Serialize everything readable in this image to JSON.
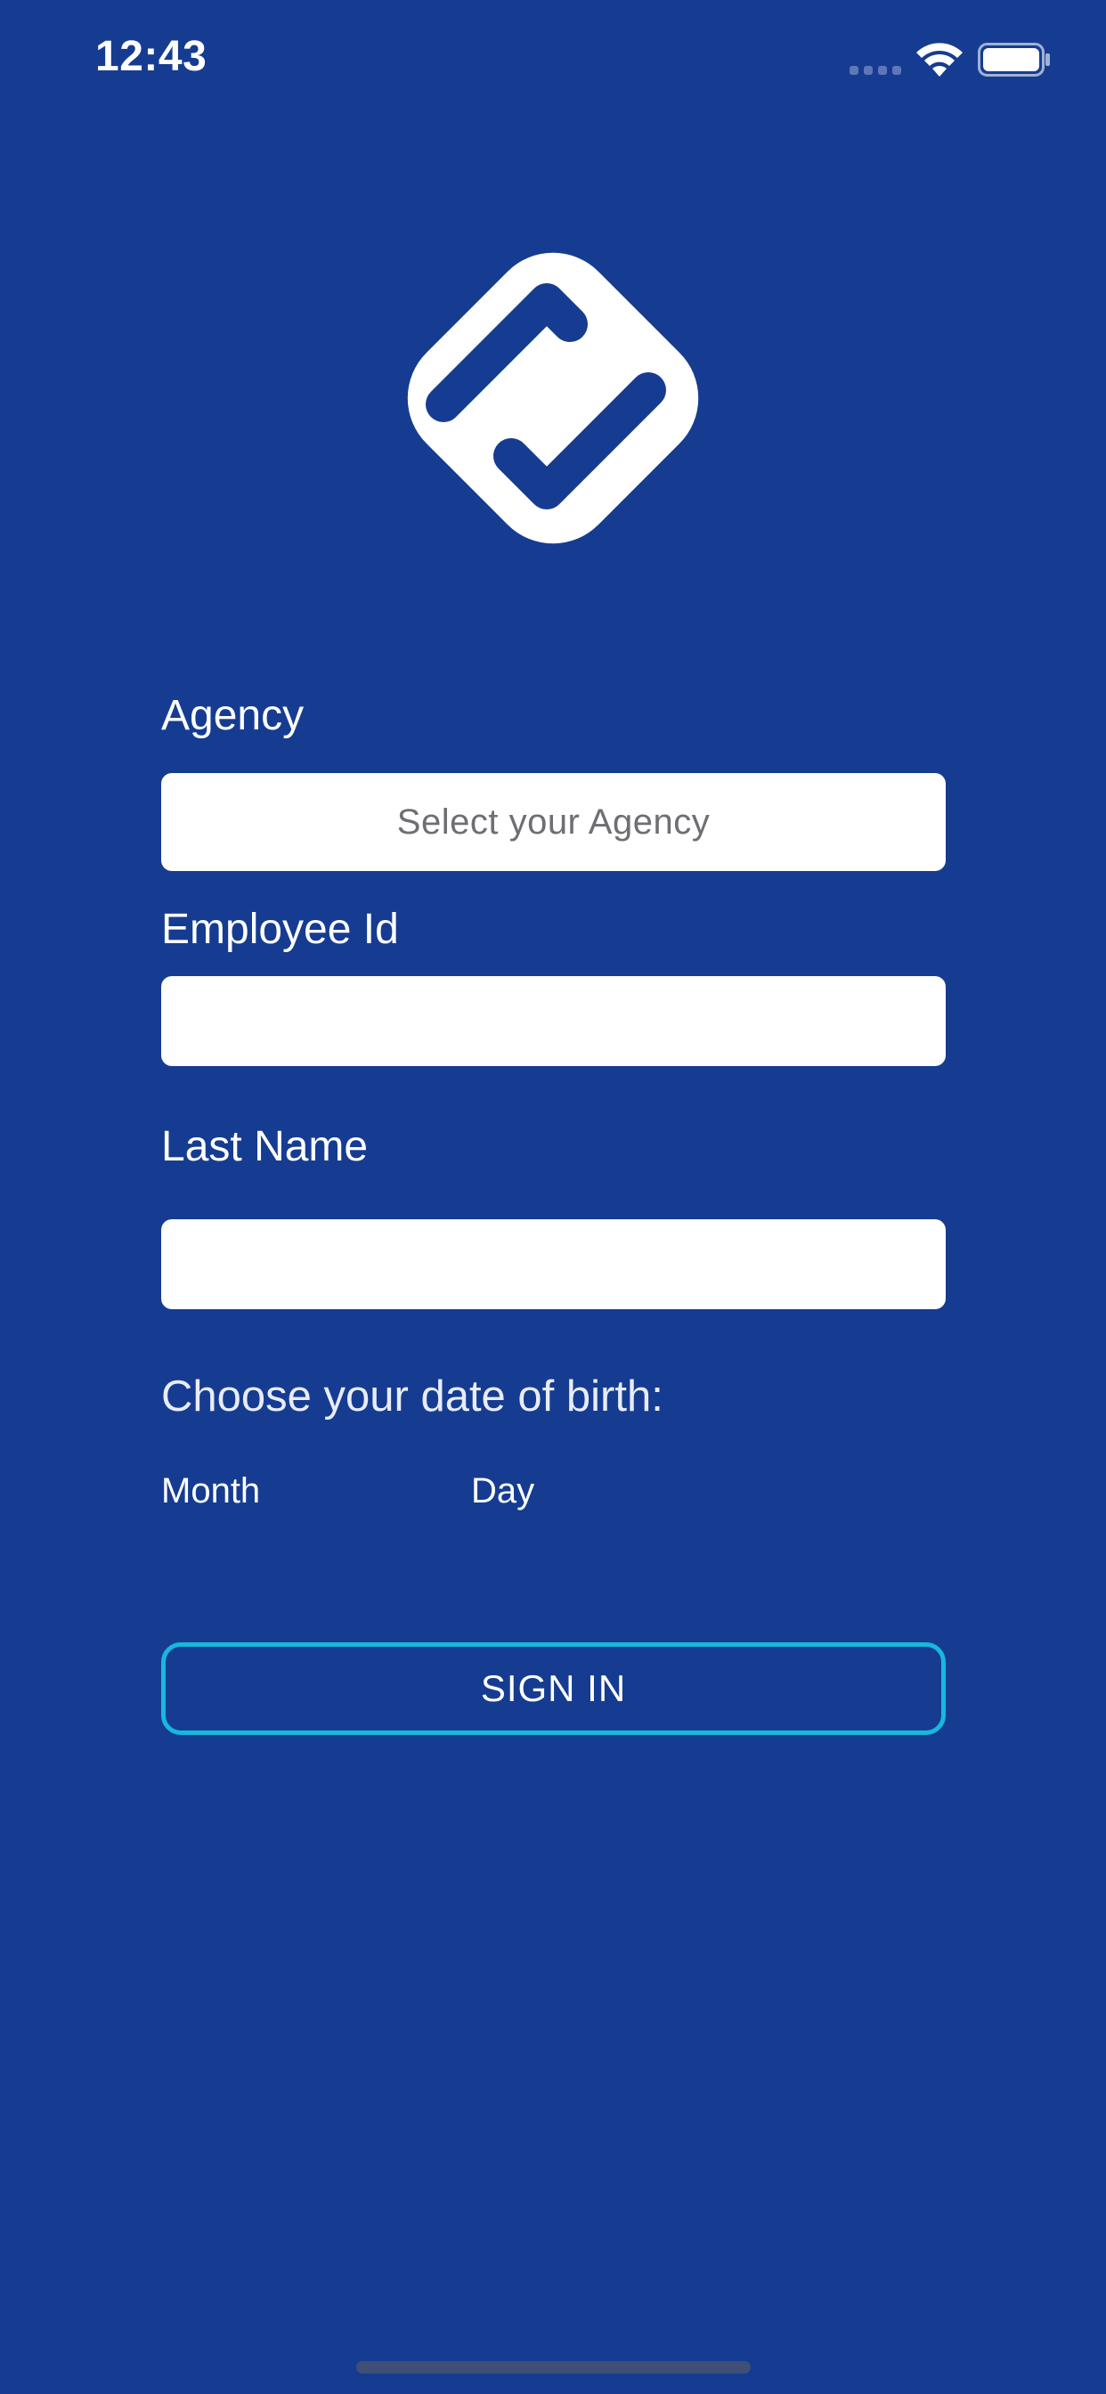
{
  "status_bar": {
    "time": "12:43",
    "icons": [
      "cellular-signal-icon",
      "wifi-icon",
      "battery-icon"
    ]
  },
  "logo": {
    "icon": "app-logo-icon"
  },
  "form": {
    "agency": {
      "label": "Agency",
      "placeholder": "Select your Agency"
    },
    "employee_id": {
      "label": "Employee Id",
      "value": ""
    },
    "last_name": {
      "label": "Last Name",
      "value": ""
    },
    "dob": {
      "label": "Choose your date of birth:",
      "month_label": "Month",
      "day_label": "Day"
    },
    "sign_in_label": "SIGN IN"
  },
  "colors": {
    "background": "#163C92",
    "button_border": "#17B8DC",
    "field_background": "#FFFFFF"
  }
}
